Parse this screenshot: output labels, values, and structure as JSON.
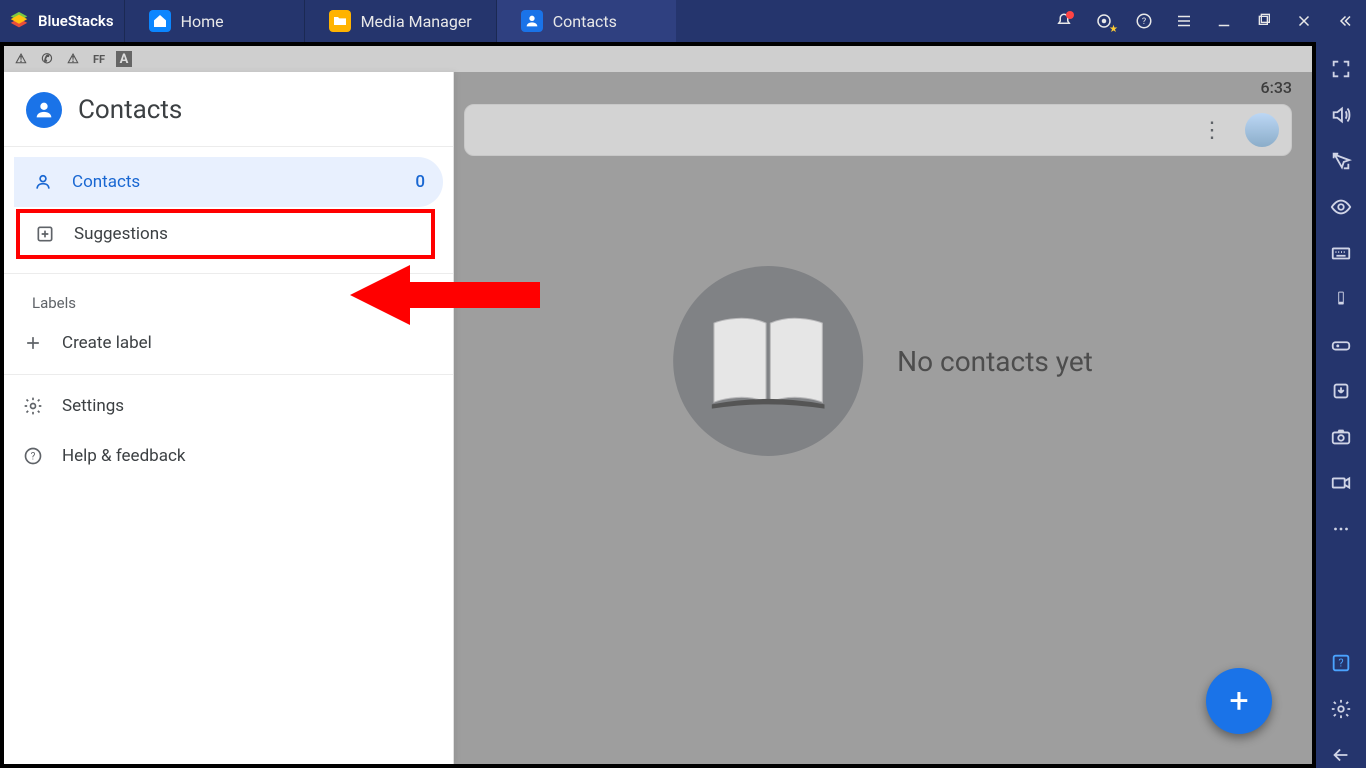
{
  "bluestacks": {
    "brand": "BlueStacks",
    "tabs": [
      {
        "label": "Home",
        "icon": "home-icon",
        "active": false
      },
      {
        "label": "Media Manager",
        "icon": "folder-icon",
        "active": false
      },
      {
        "label": "Contacts",
        "icon": "contacts-icon",
        "active": true
      }
    ],
    "window_controls": [
      "notifications",
      "target",
      "help",
      "menu",
      "minimize",
      "maximize",
      "close",
      "collapse-sidebar"
    ],
    "right_tools": [
      "fullscreen",
      "volume",
      "pointer-lock",
      "eye",
      "keyboard",
      "device-rotate",
      "gamepad",
      "install-apk",
      "screenshot",
      "record",
      "more"
    ],
    "right_tools_bottom": [
      "help-box",
      "settings",
      "back"
    ]
  },
  "android": {
    "status_clock": "6:33",
    "top_icons": [
      "warning",
      "whatsapp",
      "warning",
      "FF",
      "A"
    ]
  },
  "contacts_app": {
    "title": "Contacts",
    "nav": {
      "contacts": {
        "label": "Contacts",
        "count": "0"
      },
      "suggestions": {
        "label": "Suggestions"
      },
      "labels_header": "Labels",
      "create_label": "Create label",
      "settings": "Settings",
      "help": "Help & feedback"
    },
    "main": {
      "empty_message": "No contacts yet",
      "fab_label": "+"
    }
  }
}
